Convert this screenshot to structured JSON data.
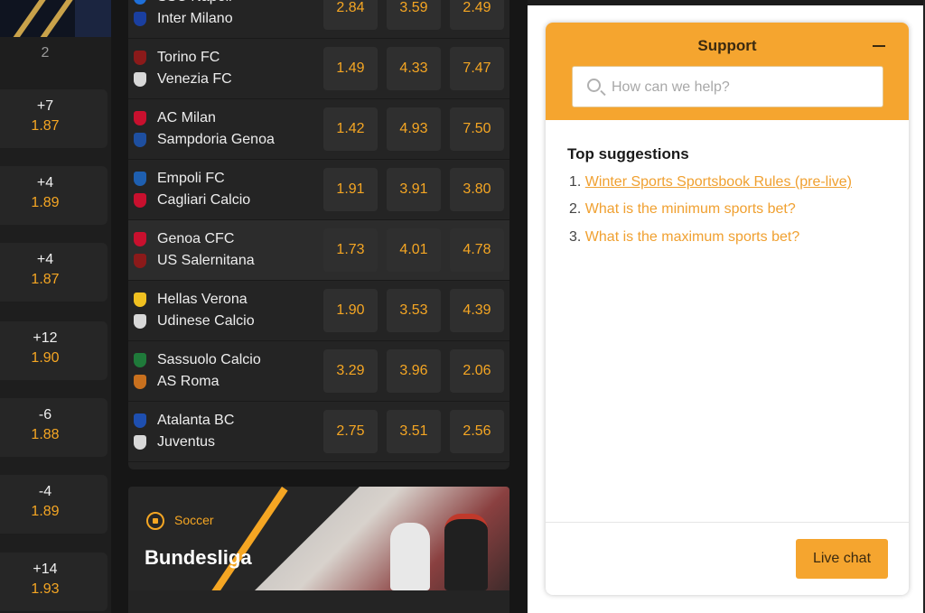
{
  "left_column": {
    "header": "2",
    "cards": [
      {
        "line": "+7",
        "odd": "1.87"
      },
      {
        "line": "+4",
        "odd": "1.89"
      },
      {
        "line": "+4",
        "odd": "1.87"
      },
      {
        "line": "+12",
        "odd": "1.90"
      },
      {
        "line": "-6",
        "odd": "1.88"
      },
      {
        "line": "-4",
        "odd": "1.89"
      },
      {
        "line": "+14",
        "odd": "1.93"
      }
    ]
  },
  "matches": [
    {
      "home": "SSC Napoli",
      "away": "Inter Milano",
      "odds": [
        "2.84",
        "3.59",
        "2.49"
      ]
    },
    {
      "home": "Torino FC",
      "away": "Venezia FC",
      "odds": [
        "1.49",
        "4.33",
        "7.47"
      ]
    },
    {
      "home": "AC Milan",
      "away": "Sampdoria Genoa",
      "odds": [
        "1.42",
        "4.93",
        "7.50"
      ]
    },
    {
      "home": "Empoli FC",
      "away": "Cagliari Calcio",
      "odds": [
        "1.91",
        "3.91",
        "3.80"
      ]
    },
    {
      "home": "Genoa CFC",
      "away": "US Salernitana",
      "odds": [
        "1.73",
        "4.01",
        "4.78"
      ]
    },
    {
      "home": "Hellas Verona",
      "away": "Udinese Calcio",
      "odds": [
        "1.90",
        "3.53",
        "4.39"
      ]
    },
    {
      "home": "Sassuolo Calcio",
      "away": "AS Roma",
      "odds": [
        "3.29",
        "3.96",
        "2.06"
      ]
    },
    {
      "home": "Atalanta BC",
      "away": "Juventus",
      "odds": [
        "2.75",
        "3.51",
        "2.56"
      ]
    }
  ],
  "crest_colors": [
    [
      "#1e6fd9",
      "#1a3fa0"
    ],
    [
      "#8b1a1a",
      "#d8d8d8"
    ],
    [
      "#c8102e",
      "#1e4fa0"
    ],
    [
      "#1e5fb0",
      "#c8102e"
    ],
    [
      "#c8102e",
      "#8b1a1a"
    ],
    [
      "#f0c020",
      "#d8d8d8"
    ],
    [
      "#1f7a3a",
      "#c8701e"
    ],
    [
      "#1e4fb0",
      "#d8d8d8"
    ]
  ],
  "banner": {
    "sport_label": "Soccer",
    "league_title": "Bundesliga"
  },
  "support": {
    "title": "Support",
    "search_placeholder": "How can we help?",
    "suggestions_title": "Top suggestions",
    "suggestions": [
      {
        "num": "1.",
        "text": "Winter Sports Sportsbook Rules (pre-live)"
      },
      {
        "num": "2.",
        "text": "What is the minimum sports bet?"
      },
      {
        "num": "3.",
        "text": "What is the maximum sports bet?"
      }
    ],
    "live_chat_label": "Live chat"
  },
  "colors": {
    "accent": "#f5a623",
    "support_header": "#f5a52f"
  }
}
